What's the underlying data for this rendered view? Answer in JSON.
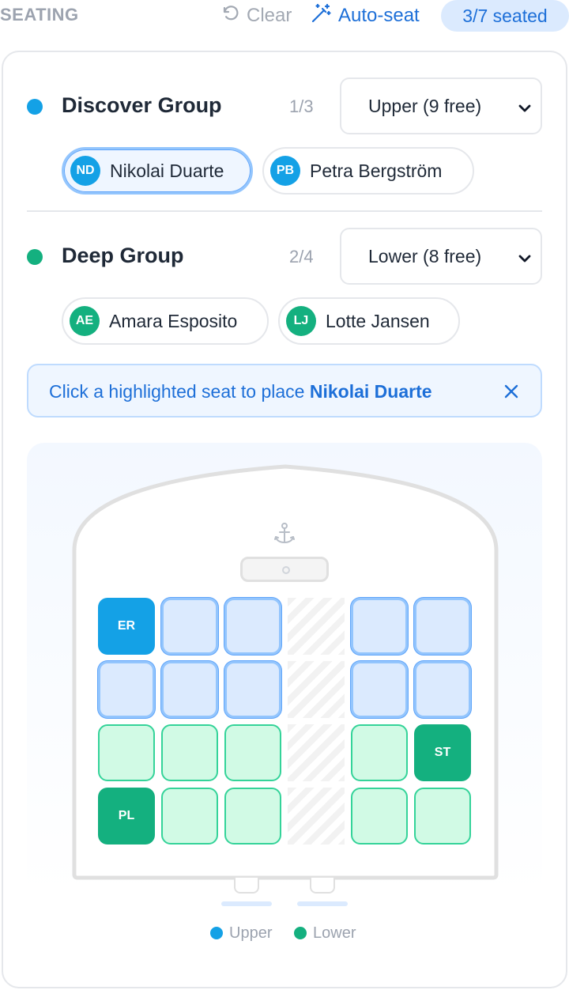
{
  "header": {
    "title": "SEATING",
    "clear_label": "Clear",
    "autoseat_label": "Auto-seat",
    "seated_badge": "3/7 seated"
  },
  "groups": [
    {
      "name": "Discover Group",
      "count": "1/3",
      "color": "#14a1e6",
      "deck_select": "Upper (9 free)",
      "members": [
        {
          "initials": "ND",
          "name": "Nikolai Duarte",
          "active": true
        },
        {
          "initials": "PB",
          "name": "Petra Bergström",
          "active": false
        }
      ]
    },
    {
      "name": "Deep Group",
      "count": "2/4",
      "color": "#14b07f",
      "deck_select": "Lower (8 free)",
      "members": [
        {
          "initials": "AE",
          "name": "Amara Esposito",
          "active": false
        },
        {
          "initials": "LJ",
          "name": "Lotte Jansen",
          "active": false
        }
      ]
    }
  ],
  "hint": {
    "prefix": "Click a highlighted seat to place ",
    "person": "Nikolai Duarte"
  },
  "seat_map": {
    "icon": "anchor-icon",
    "rows": [
      [
        {
          "state": "upper-taken",
          "label": "ER"
        },
        {
          "state": "upper-free",
          "label": ""
        },
        {
          "state": "upper-free",
          "label": ""
        },
        {
          "state": "aisle",
          "label": ""
        },
        {
          "state": "upper-free",
          "label": ""
        },
        {
          "state": "upper-free",
          "label": ""
        }
      ],
      [
        {
          "state": "upper-free",
          "label": ""
        },
        {
          "state": "upper-free",
          "label": ""
        },
        {
          "state": "upper-free",
          "label": ""
        },
        {
          "state": "aisle",
          "label": ""
        },
        {
          "state": "upper-free",
          "label": ""
        },
        {
          "state": "upper-free",
          "label": ""
        }
      ],
      [
        {
          "state": "lower-free",
          "label": ""
        },
        {
          "state": "lower-free",
          "label": ""
        },
        {
          "state": "lower-free",
          "label": ""
        },
        {
          "state": "aisle",
          "label": ""
        },
        {
          "state": "lower-free",
          "label": ""
        },
        {
          "state": "lower-taken",
          "label": "ST"
        }
      ],
      [
        {
          "state": "lower-taken",
          "label": "PL"
        },
        {
          "state": "lower-free",
          "label": ""
        },
        {
          "state": "lower-free",
          "label": ""
        },
        {
          "state": "aisle",
          "label": ""
        },
        {
          "state": "lower-free",
          "label": ""
        },
        {
          "state": "lower-free",
          "label": ""
        }
      ]
    ]
  },
  "legend": {
    "upper": {
      "label": "Upper",
      "color": "#14a1e6"
    },
    "lower": {
      "label": "Lower",
      "color": "#14b07f"
    }
  }
}
